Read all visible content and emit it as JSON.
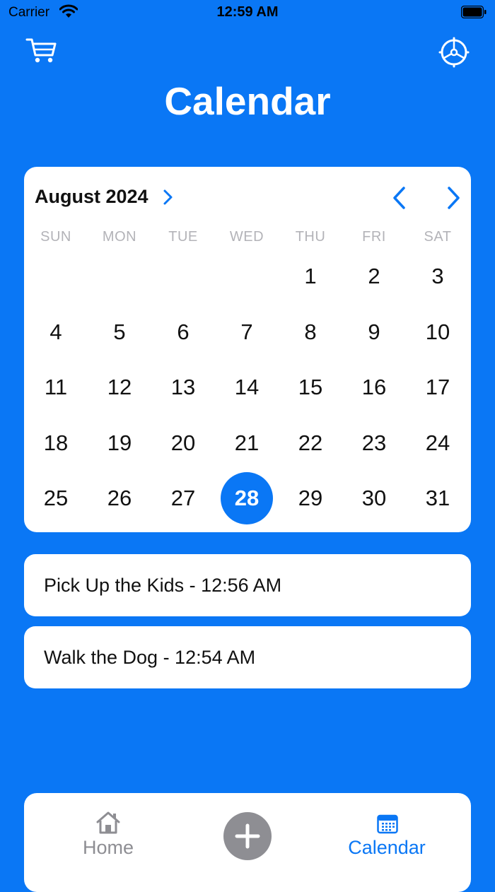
{
  "status_bar": {
    "carrier": "Carrier",
    "time": "12:59 AM"
  },
  "header": {
    "title": "Calendar",
    "cart_icon": "cart-icon",
    "settings_icon": "steering-wheel-icon"
  },
  "calendar": {
    "month_label": "August 2024",
    "weekdays": [
      "SUN",
      "MON",
      "TUE",
      "WED",
      "THU",
      "FRI",
      "SAT"
    ],
    "weeks": [
      [
        "",
        "",
        "",
        "",
        "1",
        "2",
        "3"
      ],
      [
        "4",
        "5",
        "6",
        "7",
        "8",
        "9",
        "10"
      ],
      [
        "11",
        "12",
        "13",
        "14",
        "15",
        "16",
        "17"
      ],
      [
        "18",
        "19",
        "20",
        "21",
        "22",
        "23",
        "24"
      ],
      [
        "25",
        "26",
        "27",
        "28",
        "29",
        "30",
        "31"
      ]
    ],
    "selected_day": "28"
  },
  "events": [
    {
      "text": "Pick Up the Kids - 12:56 AM"
    },
    {
      "text": "Walk the Dog - 12:54 AM"
    }
  ],
  "tab_bar": {
    "home_label": "Home",
    "calendar_label": "Calendar",
    "active_tab": "Calendar"
  },
  "colors": {
    "background": "#0A77F5",
    "accent": "#0A77F5",
    "inactive": "#8E8E93",
    "card": "#FFFFFF"
  }
}
